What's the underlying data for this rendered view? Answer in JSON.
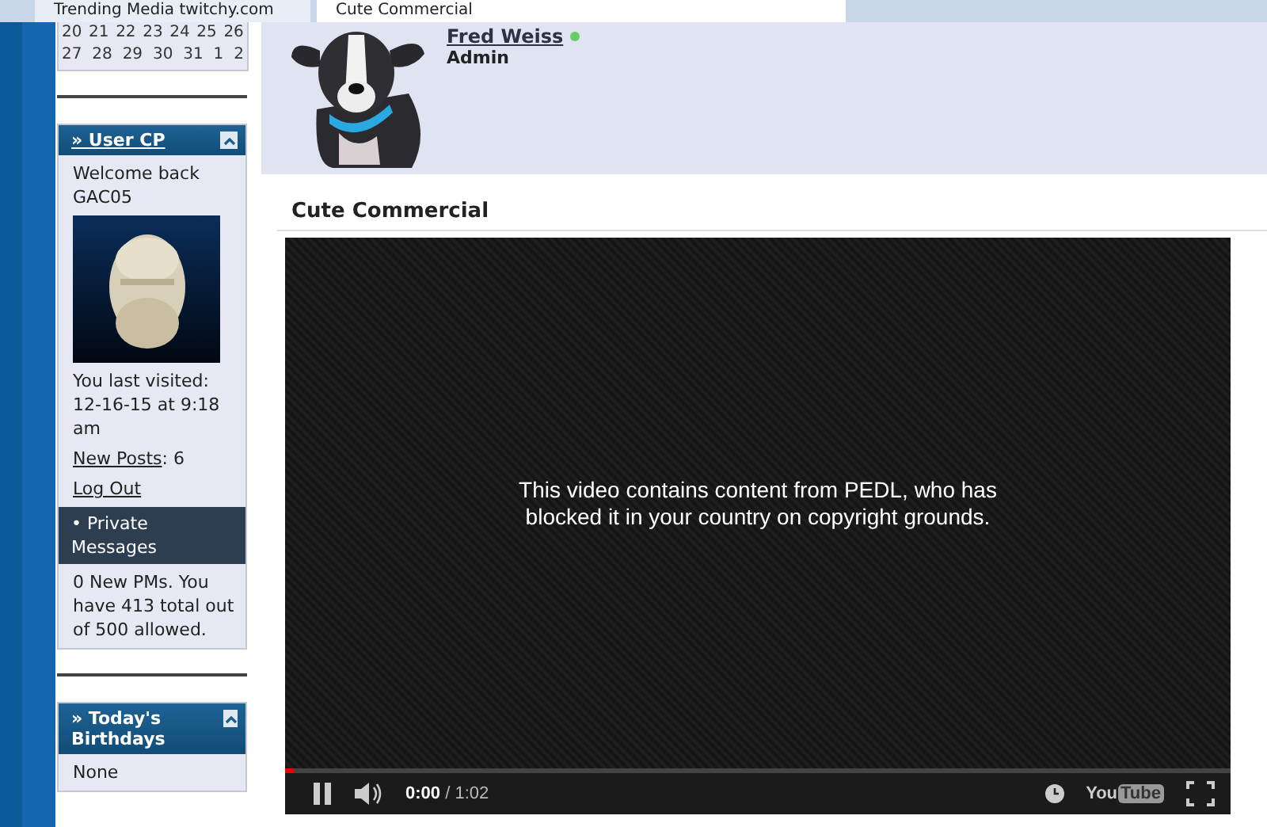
{
  "browser_tabs": [
    {
      "label": "Trending Media twitchy.com",
      "selected": false
    },
    {
      "label": "Cute Commercial",
      "selected": true
    }
  ],
  "calendar": {
    "weeks": [
      [
        "20",
        "21",
        "22",
        "23",
        "24",
        "25",
        "26"
      ],
      [
        "27",
        "28",
        "29",
        "30",
        "31",
        "1",
        "2"
      ]
    ]
  },
  "user_cp": {
    "title": "» User CP",
    "welcome": "Welcome back GAC05",
    "last_visited": "You last visited: 12-16-15 at 9:18 am",
    "new_posts_link": "New Posts",
    "new_posts_count": ": 6",
    "logout": "Log Out",
    "pm_heading": "• Private Messages",
    "pm_text": "0 New PMs. You have 413 total out of 500 allowed."
  },
  "birthdays": {
    "title": "» Today's Birthdays",
    "text": "None"
  },
  "post_author": {
    "name": "Fred Weiss",
    "online": true,
    "role": "Admin"
  },
  "post": {
    "title": "Cute Commercial",
    "video": {
      "message": "This video contains content from PEDL, who has blocked it in your country on copyright grounds.",
      "level": 0.01,
      "time_current": "0:00",
      "time_total": "/ 1:02",
      "logo_parts": [
        "You",
        "Tube"
      ]
    }
  }
}
